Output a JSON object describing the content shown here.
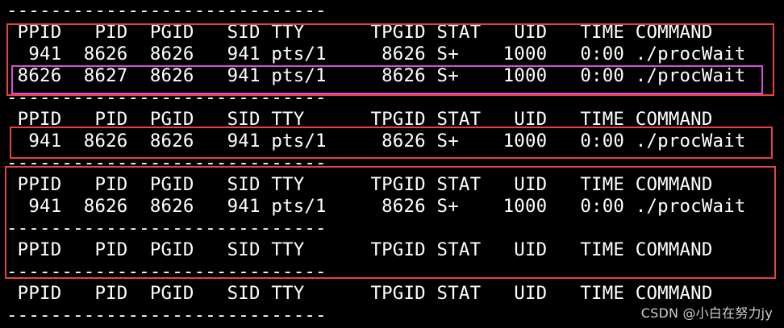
{
  "terminal": {
    "lines": [
      "-----------------------------",
      " PPID   PID  PGID   SID TTY      TPGID STAT   UID   TIME COMMAND",
      "  941  8626  8626   941 pts/1     8626 S+    1000   0:00 ./procWait",
      " 8626  8627  8626   941 pts/1     8626 S+    1000   0:00 ./procWait",
      "-----------------------------",
      " PPID   PID  PGID   SID TTY      TPGID STAT   UID   TIME COMMAND",
      "  941  8626  8626   941 pts/1     8626 S+    1000   0:00 ./procWait",
      "-----------------------------",
      " PPID   PID  PGID   SID TTY      TPGID STAT   UID   TIME COMMAND",
      "  941  8626  8626   941 pts/1     8626 S+    1000   0:00 ./procWait",
      "-----------------------------",
      " PPID   PID  PGID   SID TTY      TPGID STAT   UID   TIME COMMAND",
      "-----------------------------",
      " PPID   PID  PGID   SID TTY      TPGID STAT   UID   TIME COMMAND",
      "-----------------------------"
    ]
  },
  "annotations": {
    "red_color": "#e8413f",
    "magenta_color": "#d64fd6"
  },
  "watermark": {
    "text": "CSDN @小白在努力jy"
  }
}
